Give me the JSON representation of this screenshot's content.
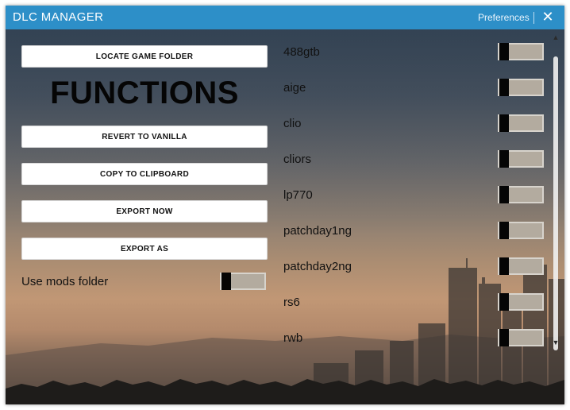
{
  "window": {
    "title": "DLC MANAGER",
    "preferences_label": "Preferences",
    "close_glyph": "✕"
  },
  "left": {
    "locate_label": "LOCATE GAME FOLDER",
    "functions_heading": "FUNCTIONS",
    "revert_label": "REVERT TO VANILLA",
    "copy_label": "COPY TO CLIPBOARD",
    "export_now_label": "EXPORT NOW",
    "export_as_label": "EXPORT AS",
    "mods_folder_label": "Use mods folder",
    "mods_folder_enabled": false
  },
  "dlc_list": [
    {
      "label": "488gtb",
      "enabled": false
    },
    {
      "label": "aige",
      "enabled": false
    },
    {
      "label": "clio",
      "enabled": false
    },
    {
      "label": "cliors",
      "enabled": false
    },
    {
      "label": "lp770",
      "enabled": false
    },
    {
      "label": "patchday1ng",
      "enabled": false
    },
    {
      "label": "patchday2ng",
      "enabled": false
    },
    {
      "label": "rs6",
      "enabled": false
    },
    {
      "label": "rwb",
      "enabled": false
    }
  ],
  "scrollbar": {
    "up_glyph": "▲",
    "down_glyph": "▼"
  },
  "colors": {
    "titlebar": "#2d8fc8",
    "toggle_track": "#b3ab9f",
    "toggle_knob": "#050505"
  },
  "icons": {
    "close": "close-icon",
    "scroll_up": "scroll-up-arrow-icon",
    "scroll_down": "scroll-down-arrow-icon"
  }
}
